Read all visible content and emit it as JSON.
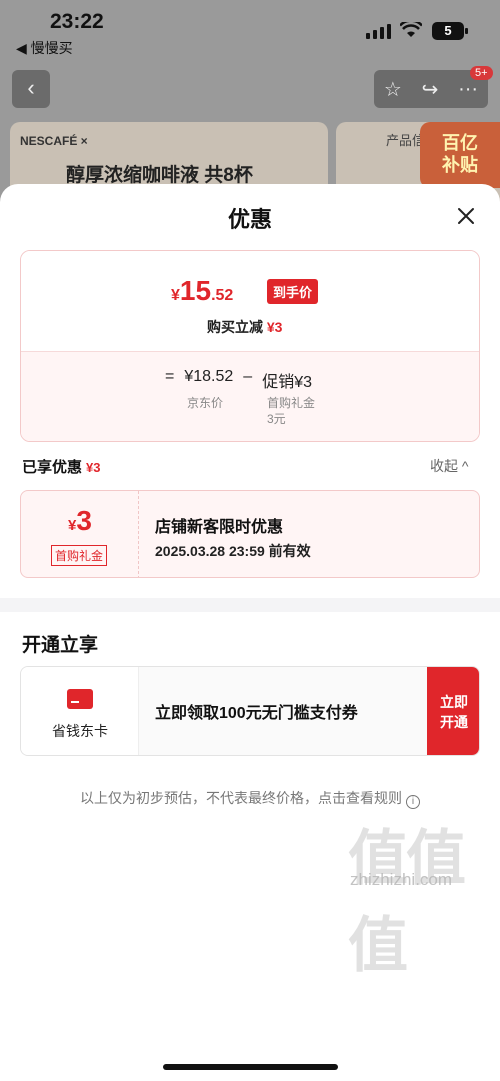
{
  "status_bar": {
    "time": "23:22",
    "back_app": "◀ 慢慢买",
    "battery": "5"
  },
  "background": {
    "nav_badge": "5+",
    "brand": "NESCAFÉ ×",
    "product_title": "醇厚浓缩咖啡液 共8杯",
    "right_label": "产品信",
    "subsidy_line1": "百亿",
    "subsidy_line2": "补贴"
  },
  "sheet": {
    "title": "优惠",
    "price": {
      "symbol": "¥",
      "integer": "15",
      "decimal": ".52",
      "tag": "到手价",
      "instant_label": "购买立减",
      "instant_amount": "¥3"
    },
    "calc": {
      "equals": "=",
      "jd_price": "¥18.52",
      "minus": "–",
      "promo": "促销¥3",
      "jd_price_label": "京东价",
      "promo_sub1": "首购礼金",
      "promo_sub2": "3元"
    },
    "enjoyed": {
      "label": "已享优惠",
      "amount": "¥3",
      "collapse": "收起 ^"
    },
    "coupon": {
      "symbol": "¥",
      "amount": "3",
      "type": "首购礼金",
      "title": "店铺新客限时优惠",
      "expiry": "2025.03.28 23:59 前有效"
    },
    "open_section": {
      "label": "开通立享",
      "card_name": "省钱东卡",
      "offer": "立即领取100元无门槛支付券",
      "button": "立即开通"
    },
    "disclaimer": "以上仅为初步预估，不代表最终价格，点击查看规则"
  },
  "watermark": {
    "logo": "值值值",
    "url": "zhizhizhi.com"
  },
  "colors": {
    "accent_red": "#e0262b",
    "pink_bg": "#fff5f5"
  }
}
